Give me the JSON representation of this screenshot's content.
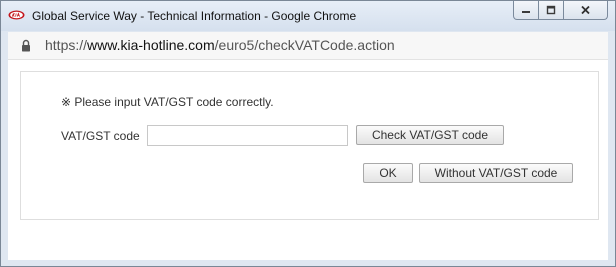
{
  "window": {
    "title": "Global Service Way - Technical Information - Google Chrome",
    "app_icon": "kia-logo-icon",
    "controls": [
      "minimize-icon",
      "maximize-icon",
      "close-icon"
    ]
  },
  "address_bar": {
    "lock_icon": "lock-icon",
    "url_prefix": "https://",
    "url_host": "www.kia-hotline.com",
    "url_path": "/euro5/checkVATCode.action"
  },
  "form": {
    "notice": "※ Please input VAT/GST code correctly.",
    "field_label": "VAT/GST code",
    "input_value": "",
    "input_placeholder": "",
    "check_button": "Check VAT/GST code",
    "ok_button": "OK",
    "without_button": "Without VAT/GST code"
  },
  "colors": {
    "titlebar": "#dfe7f1",
    "close_hover_accent": "#c7463f",
    "kia_red": "#c4161c"
  }
}
